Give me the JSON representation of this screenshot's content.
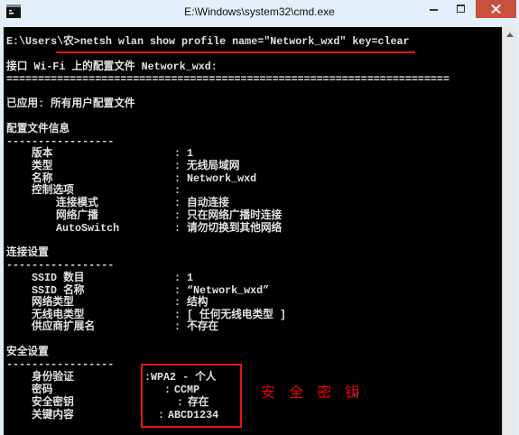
{
  "window": {
    "title": "E:\\Windows\\system32\\cmd.exe",
    "app_icon": "cmd-icon",
    "controls": [
      "minimize-icon",
      "maximize-icon",
      "close-icon"
    ]
  },
  "console": {
    "prompt": "E:\\Users\\农>",
    "command": "netsh wlan show profile name=\"Network_wxd\" key=clear",
    "header": "接口 Wi-Fi 上的配置文件 Network_wxd:",
    "rule_double": "======================================================================",
    "applied": "已应用: 所有用户配置文件",
    "kv_separator": ":",
    "profile_info": {
      "title": "配置文件信息",
      "rule": "-----------------",
      "items": [
        {
          "label": "版本",
          "value": "1"
        },
        {
          "label": "类型",
          "value": "无线局域网"
        },
        {
          "label": "名称",
          "value": "Network_wxd"
        },
        {
          "label": "控制选项",
          "value": "",
          "children": [
            {
              "label": "连接模式",
              "value": "自动连接"
            },
            {
              "label": "网络广播",
              "value": "只在网络广播时连接"
            },
            {
              "label": "AutoSwitch",
              "value": "请勿切换到其他网络"
            }
          ]
        }
      ]
    },
    "connectivity": {
      "title": "连接设置",
      "rule": "-----------------",
      "items": [
        {
          "label": "SSID 数目",
          "value": "1"
        },
        {
          "label": "SSID 名称",
          "value": "“Network_wxd”"
        },
        {
          "label": "网络类型",
          "value": "结构"
        },
        {
          "label": "无线电类型",
          "value": "[ 任何无线电类型 ]"
        },
        {
          "label": "供应商扩展名",
          "value": "不存在"
        }
      ]
    },
    "security": {
      "title": "安全设置",
      "rule": "-----------------",
      "items": [
        {
          "label": "身份验证",
          "value": "WPA2 - 个人"
        },
        {
          "label": "密码",
          "value": "CCMP"
        },
        {
          "label": "安全密钥",
          "value": "存在"
        },
        {
          "label": "关键内容",
          "value": "ABCD1234"
        }
      ]
    }
  },
  "annotation": {
    "label": "安 全 密 钥",
    "mark": "↵"
  },
  "colors": {
    "frame": "#e4eef9",
    "close_button": "#c7503f",
    "console_bg": "#000000",
    "console_text": "#e2e2e2",
    "annotation_red": "#e8141c"
  }
}
